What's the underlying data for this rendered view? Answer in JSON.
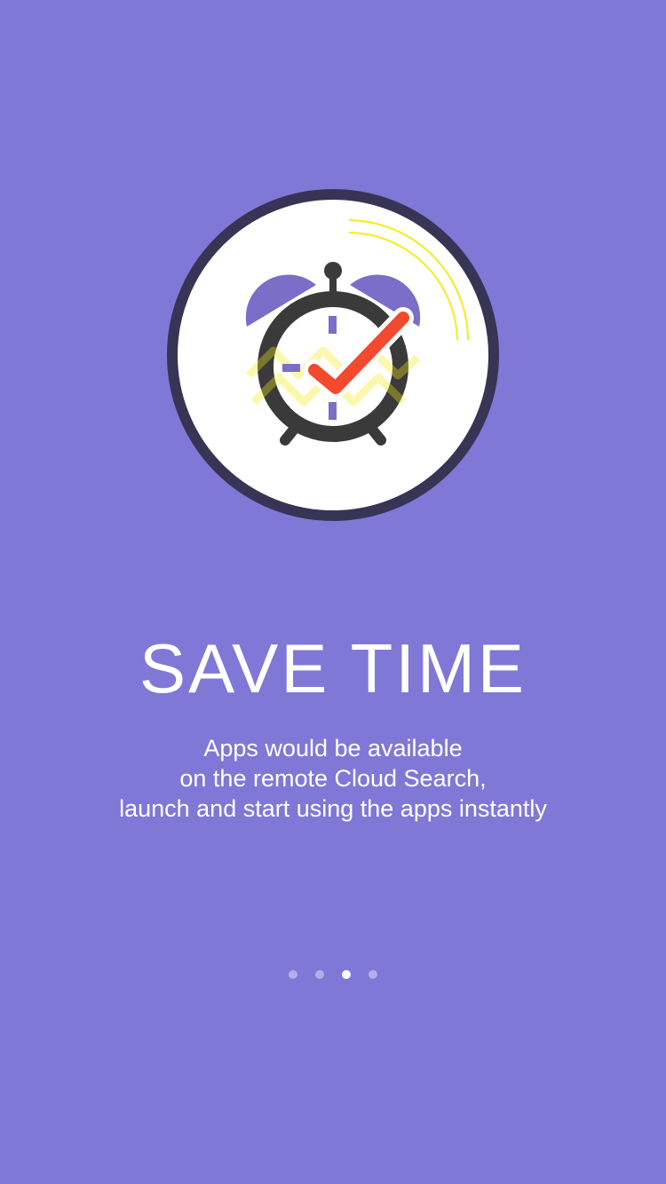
{
  "colors": {
    "background": "#8078D6",
    "circle_border": "#383456",
    "circle_fill": "#FFFFFF",
    "clock_body": "#3A3A3A",
    "bell": "#7A6EC8",
    "clock_face_accent": "#48D0E0",
    "check_mark": "#F2492F",
    "motion_lines": "#F5EC1A",
    "dot_active": "#FFFFFF",
    "dot_inactive": "#B3AEE8"
  },
  "illustration": {
    "icon": "alarm-clock-check-icon"
  },
  "onboarding": {
    "title": "SAVE TIME",
    "subtitle_line1": "Apps would be available",
    "subtitle_line2": "on the remote Cloud Search,",
    "subtitle_line3": "launch and start using the apps instantly"
  },
  "pager": {
    "total_pages": 4,
    "active_index": 2
  }
}
